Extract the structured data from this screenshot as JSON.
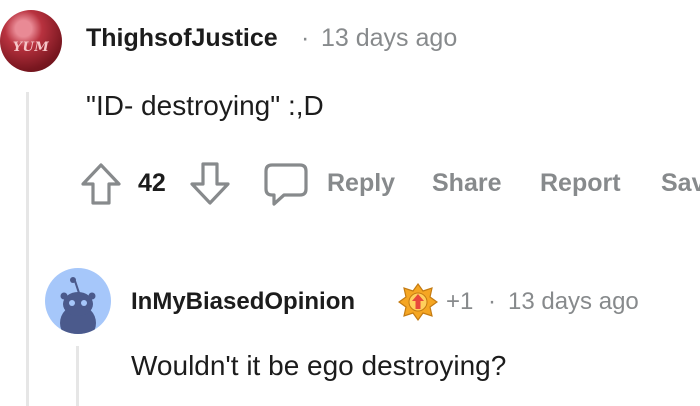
{
  "comments": [
    {
      "username": "ThighsofJustice",
      "separator": "·",
      "timestamp": "13 days ago",
      "body": "\"ID- destroying\" :,D",
      "avatar_text": "YUM",
      "score": "42"
    },
    {
      "username": "InMyBiasedOpinion",
      "award_count": "+1",
      "separator": "·",
      "timestamp": "13 days ago",
      "body": "Wouldn't it be ego destroying?"
    }
  ],
  "actions": {
    "reply": "Reply",
    "share": "Share",
    "report": "Report",
    "save": "Save"
  },
  "colors": {
    "meta_gray": "#878a8c",
    "text": "#1c1c1c",
    "avatar_blue": "#a6c7fa",
    "thread_line": "#e6e6e6"
  }
}
